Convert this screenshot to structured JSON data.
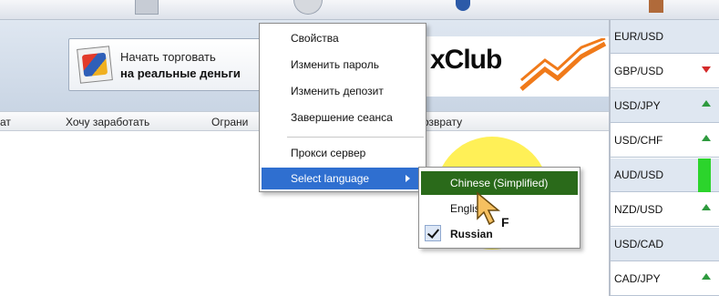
{
  "toolbar": {
    "icons": [
      "chart-icon",
      "clock-icon",
      "globe-icon",
      "exit-icon"
    ]
  },
  "promo": {
    "line1": "Начать торговать",
    "line2": "на реальные деньги"
  },
  "logo": {
    "text": "xClub",
    "colors": {
      "text": "#0b0b0b",
      "mark": "#f07a1a"
    }
  },
  "columns": [
    "ат",
    "Хочу заработать",
    "Ограни",
    "озврату"
  ],
  "sidebar": {
    "pairs": [
      {
        "label": "EUR/USD",
        "trend": "none"
      },
      {
        "label": "GBP/USD",
        "trend": "down"
      },
      {
        "label": "USD/JPY",
        "trend": "up"
      },
      {
        "label": "USD/CHF",
        "trend": "up"
      },
      {
        "label": "AUD/USD",
        "trend": "highlight"
      },
      {
        "label": "NZD/USD",
        "trend": "up"
      },
      {
        "label": "USD/CAD",
        "trend": "none"
      },
      {
        "label": "CAD/JPY",
        "trend": "up"
      }
    ]
  },
  "menu": {
    "items": [
      {
        "label": "Свойства"
      },
      {
        "label": "Изменить пароль"
      },
      {
        "label": "Изменить депозит"
      },
      {
        "label": "Завершение сеанса"
      },
      {
        "label": "Прокси сервер"
      },
      {
        "label": "Select language",
        "selected": true
      }
    ]
  },
  "language_menu": {
    "items": [
      {
        "label": "Chinese (Simplified)",
        "selected": true
      },
      {
        "label": "English"
      },
      {
        "label": "Russian",
        "checked": true
      }
    ]
  },
  "cursor_label": "F",
  "colors": {
    "menu_selected": "#2f6fd0",
    "submenu_selected": "#2a6a1a",
    "highlight": "#ffec28",
    "arrow_up": "#2e9a3e",
    "arrow_down": "#d42a2a"
  }
}
